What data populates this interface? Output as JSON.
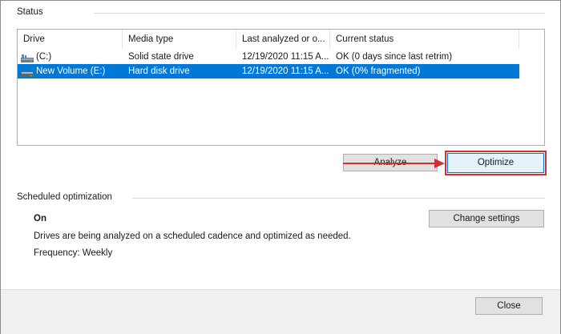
{
  "status_section": {
    "label": "Status"
  },
  "drive_list": {
    "columns": [
      "Drive",
      "Media type",
      "Last analyzed or o...",
      "Current status"
    ],
    "rows": [
      {
        "drive": "(C:)",
        "media_type": "Solid state drive",
        "last_analyzed": "12/19/2020 11:15 A...",
        "status": "OK (0 days since last retrim)",
        "icon": "ssd-drive-icon",
        "selected": false
      },
      {
        "drive": "New Volume (E:)",
        "media_type": "Hard disk drive",
        "last_analyzed": "12/19/2020 11:15 A...",
        "status": "OK (0% fragmented)",
        "icon": "hard-disk-drive-icon",
        "selected": true
      }
    ]
  },
  "buttons": {
    "analyze": "Analyze",
    "optimize": "Optimize",
    "change_settings": "Change settings",
    "close": "Close"
  },
  "scheduled": {
    "label": "Scheduled optimization",
    "state": "On",
    "description": "Drives are being analyzed on a scheduled cadence and optimized as needed.",
    "frequency": "Frequency: Weekly"
  },
  "colors": {
    "selection": "#0078d7",
    "annotation": "#d32f2f",
    "focus_border": "#0078d7"
  }
}
